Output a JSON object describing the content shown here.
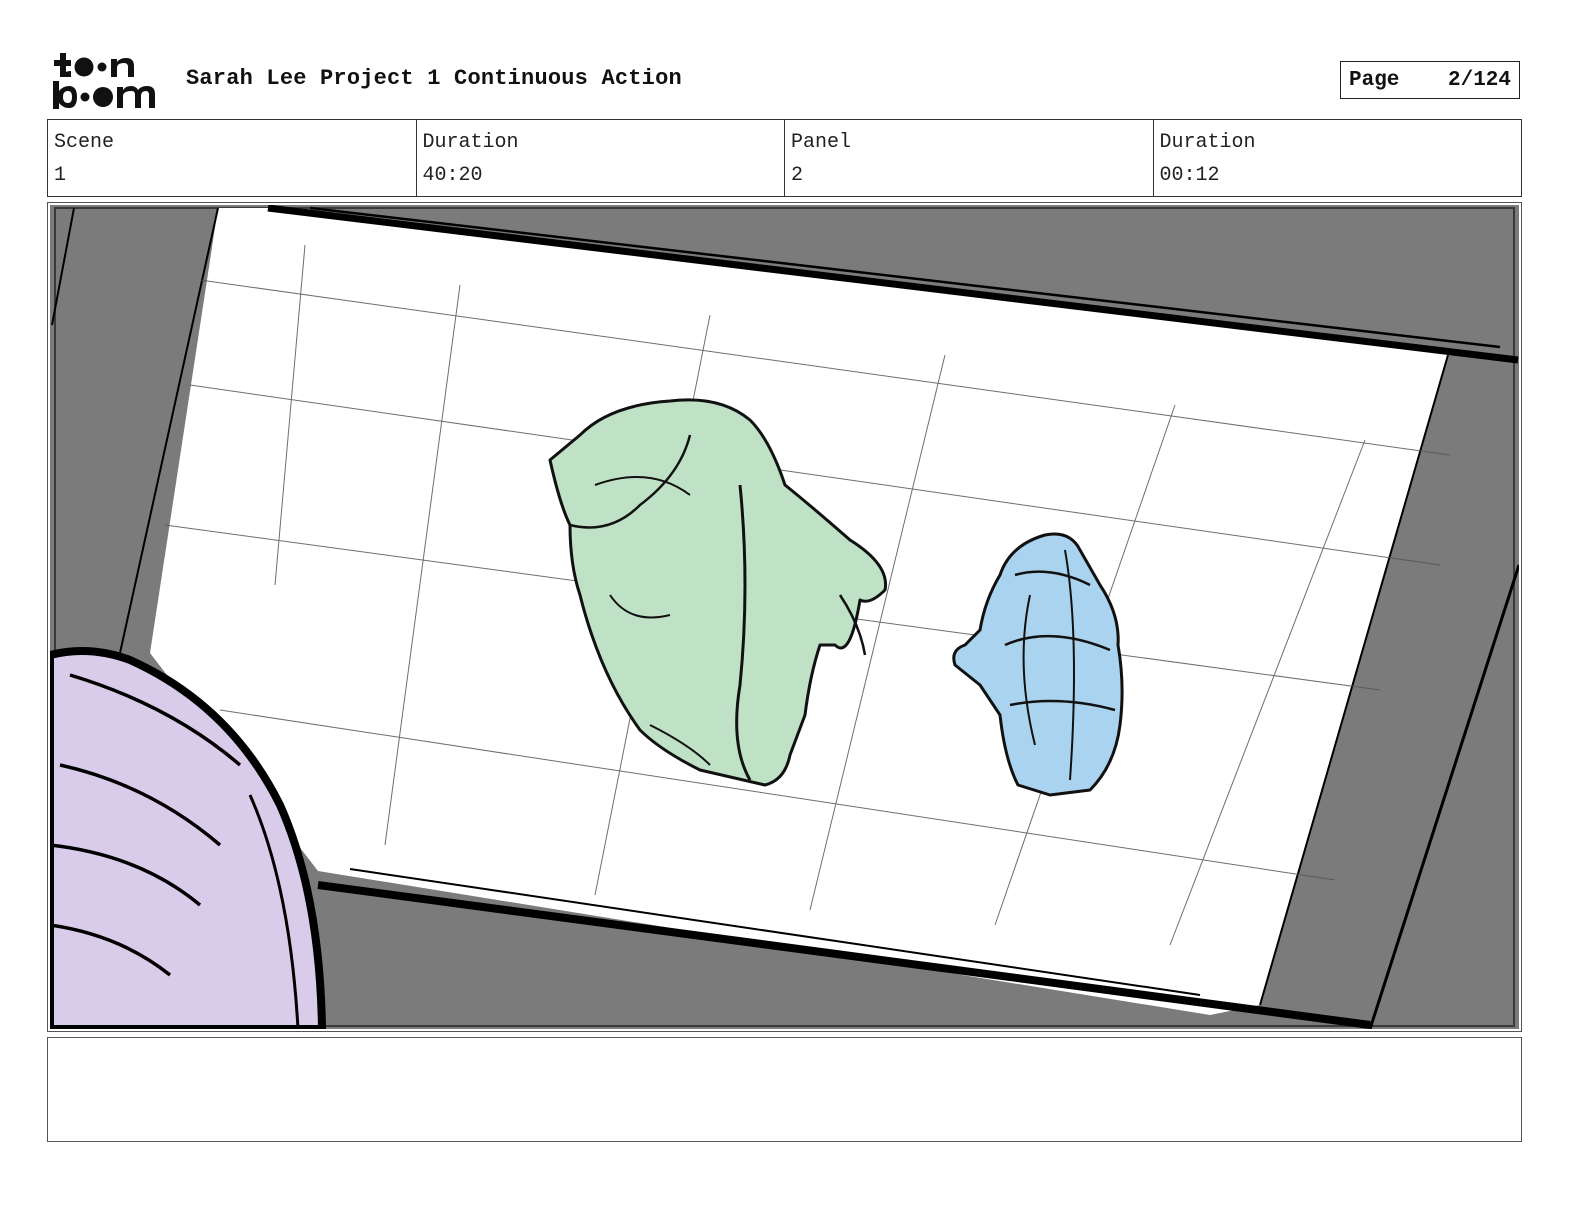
{
  "header": {
    "logo_text": "toon boom",
    "project_title": "Sarah Lee Project 1 Continuous Action",
    "page_label": "Page",
    "page_number": "2/124"
  },
  "info": {
    "scene_label": "Scene",
    "scene_value": "1",
    "scene_duration_label": "Duration",
    "scene_duration_value": "40:20",
    "panel_label": "Panel",
    "panel_value": "2",
    "panel_duration_label": "Duration",
    "panel_duration_value": "00:12"
  },
  "colors": {
    "frame_gray": "#7b7b7b",
    "figure_green": "#bfe2c6",
    "figure_blue": "#a9d3ee",
    "figure_purple": "#d9cbea",
    "ink": "#111111"
  },
  "notes": {
    "text": ""
  }
}
